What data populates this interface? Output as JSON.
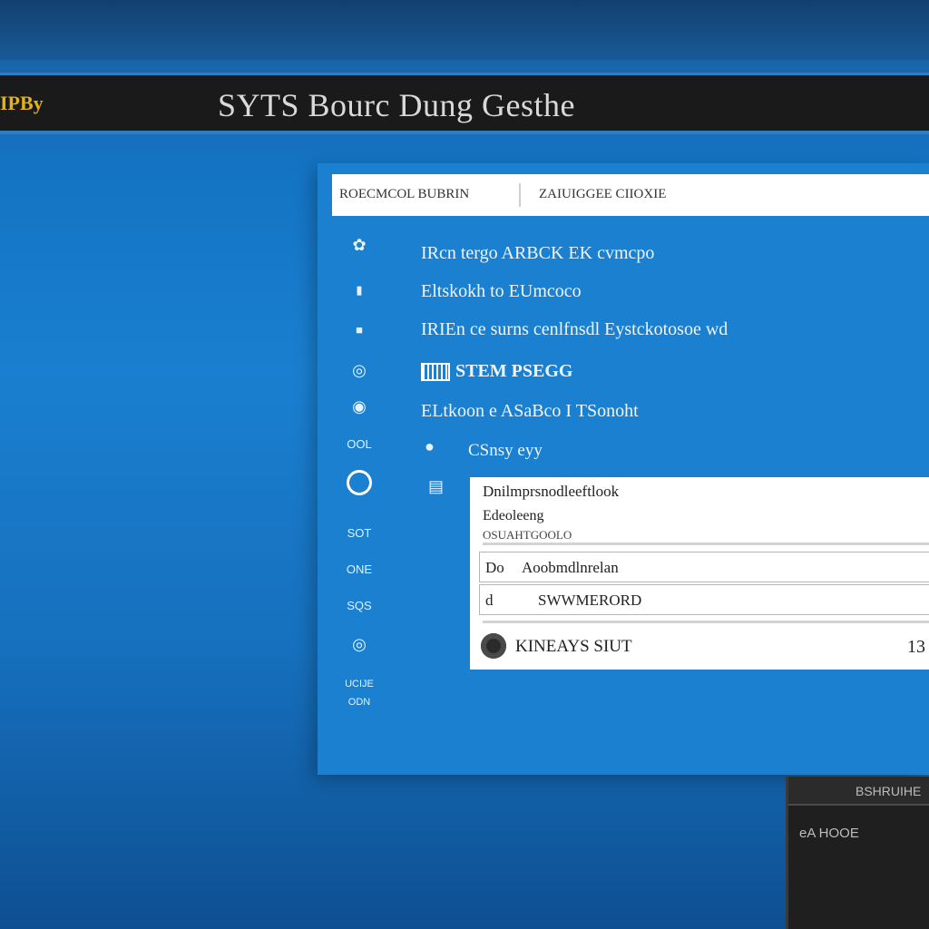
{
  "app": {
    "brand": "IPBy",
    "title": "SYTS Bourc Dung Gesthe"
  },
  "window": {
    "header_left": "ROECMCOL BUBRIN",
    "header_right": "ZAIUIGGEE CIIOXIE"
  },
  "sidebar_icons": [
    {
      "glyph": "✿",
      "name": "gear-cluster-icon"
    },
    {
      "glyph": "▮",
      "name": "bookmark-icon"
    },
    {
      "glyph": "■",
      "name": "square-icon"
    },
    {
      "glyph": "◎",
      "name": "target-icon"
    },
    {
      "glyph": "◉",
      "name": "globe-icon"
    },
    {
      "glyph": "OOL",
      "name": "ool-icon"
    },
    {
      "glyph": "",
      "name": "circle-icon"
    },
    {
      "glyph": "SOT",
      "name": "sot-icon"
    },
    {
      "glyph": "ONE",
      "name": "one-icon"
    },
    {
      "glyph": "SQS",
      "name": "sqs-icon"
    },
    {
      "glyph": "◎",
      "name": "disc-icon"
    },
    {
      "glyph": "UCIJE",
      "name": "ucije-icon"
    },
    {
      "glyph": "ODN",
      "name": "odn-icon"
    }
  ],
  "list_items": [
    "IRcn tergo ARBCK EK cvmcpo",
    "Eltskokh to EUmcoco",
    "IRIEn ce surns cenlfnsdl Eystckotosoe wd",
    "STEM PSEGG",
    "ELtkoon e ASaBco I TSonoht"
  ],
  "sub_item": {
    "icon": "●",
    "label": "CSnsy eyy",
    "doc_icon": "▤"
  },
  "dialog": {
    "title": "Dnilmprsnodleeftlook",
    "subtitle": "Edeoleeng",
    "meta": "OSUAHTGOOLO",
    "field1": {
      "prefix": "Do",
      "value": "Aoobmdlnrelan"
    },
    "field2": {
      "prefix": "d",
      "value": "SWWMERORD"
    },
    "footer_text": "KINEAYS SIUT",
    "footer_num": "13"
  },
  "dark_panel": {
    "title": "BSHRUIHE",
    "body": "eA HOOE"
  }
}
